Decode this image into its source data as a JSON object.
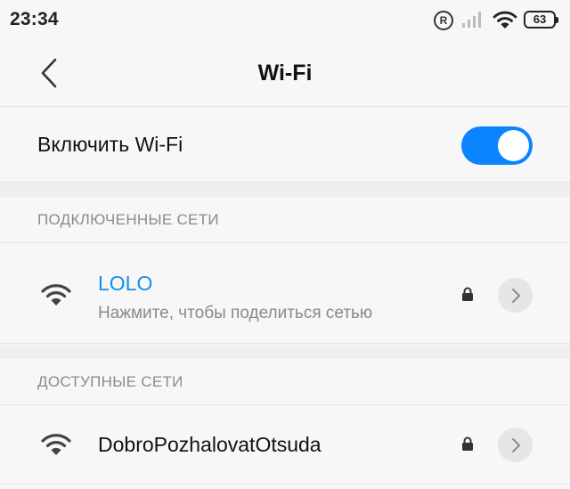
{
  "status_bar": {
    "time": "23:34",
    "r_badge": "R",
    "battery": "63",
    "icons": [
      "registered-icon",
      "signal-icon",
      "wifi-icon",
      "battery-icon"
    ]
  },
  "header": {
    "title": "Wi-Fi",
    "back_icon": "chevron-left-icon"
  },
  "wifi_toggle": {
    "label": "Включить Wi-Fi",
    "enabled": true,
    "accent_color": "#0d84ff"
  },
  "connected_section": {
    "title": "ПОДКЛЮЧЕННЫЕ СЕТИ",
    "networks": [
      {
        "name": "LOLO",
        "subtitle": "Нажмите, чтобы поделиться сетью",
        "locked": true,
        "color": "#1590e6"
      }
    ]
  },
  "available_section": {
    "title": "ДОСТУПНЫЕ СЕТИ",
    "networks": [
      {
        "name": "DobroPozhalovatOtsuda",
        "locked": true
      }
    ]
  }
}
